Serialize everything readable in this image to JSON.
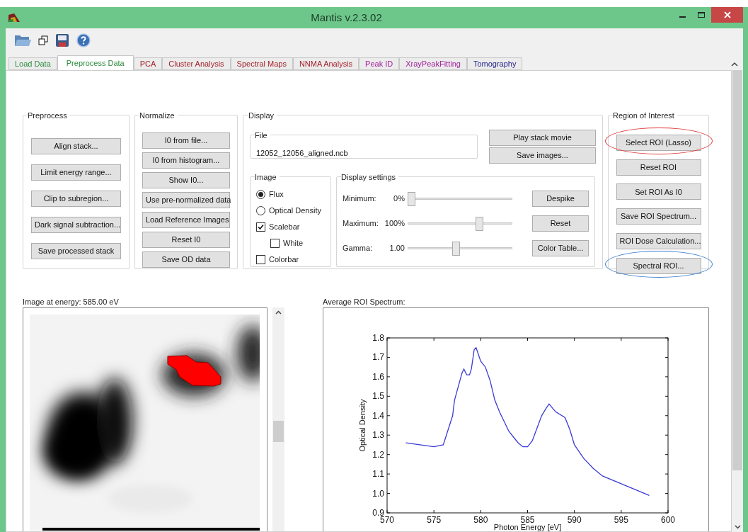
{
  "window": {
    "title": "Mantis v.2.3.02"
  },
  "tabs": [
    {
      "label": "Load Data",
      "selected": false,
      "color": "#2e8b3e"
    },
    {
      "label": "Preprocess Data",
      "selected": true,
      "color": "#2e8b3e"
    },
    {
      "label": "PCA",
      "selected": false,
      "color": "#a3212b"
    },
    {
      "label": "Cluster Analysis",
      "selected": false,
      "color": "#a3212b"
    },
    {
      "label": "Spectral Maps",
      "selected": false,
      "color": "#a3212b"
    },
    {
      "label": "NNMA Analysis",
      "selected": false,
      "color": "#a3212b"
    },
    {
      "label": "Peak ID",
      "selected": false,
      "color": "#a0209a"
    },
    {
      "label": "XrayPeakFitting",
      "selected": false,
      "color": "#a0209a"
    },
    {
      "label": "Tomography",
      "selected": false,
      "color": "#23238e"
    }
  ],
  "preprocess": {
    "title": "Preprocess",
    "buttons": [
      "Align stack...",
      "Limit energy range...",
      "Clip to subregion...",
      "Dark signal subtraction...",
      "Save processed stack"
    ]
  },
  "normalize": {
    "title": "Normalize",
    "buttons": [
      "I0 from file...",
      "I0 from histogram...",
      "Show I0...",
      "Use pre-normalized data",
      "Load Reference Images",
      "Reset I0",
      "Save OD data"
    ]
  },
  "display": {
    "title": "Display",
    "file": {
      "title": "File",
      "value": "12052_12056_aligned.ncb"
    },
    "buttons": [
      "Play stack movie",
      "Save images..."
    ],
    "image": {
      "title": "Image",
      "options": [
        {
          "kind": "radio",
          "label": "Flux",
          "selected": true
        },
        {
          "kind": "radio",
          "label": "Optical Density",
          "selected": false
        },
        {
          "kind": "checkbox",
          "label": "Scalebar",
          "checked": true,
          "children": [
            {
              "kind": "checkbox",
              "label": "White",
              "checked": false
            }
          ]
        },
        {
          "kind": "checkbox",
          "label": "Colorbar",
          "checked": false
        }
      ]
    },
    "settings": {
      "title": "Display settings",
      "rows": [
        {
          "label": "Minimum:",
          "reading": "0%",
          "level": 0,
          "button": "Despike"
        },
        {
          "label": "Maximum:",
          "reading": "100%",
          "level": 0.7,
          "button": "Reset"
        },
        {
          "label": "Gamma:",
          "reading": "1.00",
          "level": 0.46,
          "button": "Color Table..."
        }
      ]
    }
  },
  "roi": {
    "title": "Region of Interest",
    "buttons": [
      {
        "label": "Select ROI (Lasso)",
        "color": "#e03b3b"
      },
      {
        "label": "Reset ROI"
      },
      {
        "label": "Set ROI As I0"
      },
      {
        "label": "Save ROI Spectrum..."
      },
      {
        "label": "ROI Dose Calculation..."
      },
      {
        "label": "Spectral ROI...",
        "color": "#3b7fd0"
      }
    ]
  },
  "image_panel": {
    "title": "Image at energy: 585.00 eV",
    "kind": "picture"
  },
  "spectrum_panel": {
    "title": "Average ROI Spectrum:",
    "chart_data": {
      "type": "line",
      "xlabel": "Photon Energy [eV]",
      "ylabel": "Optical Density",
      "x": [
        572,
        575,
        576,
        577,
        577.2,
        578,
        578.2,
        578.5,
        578.8,
        579,
        579.3,
        579.5,
        580,
        580.5,
        581,
        581.5,
        582,
        583,
        583.5,
        584,
        584.5,
        585,
        585.5,
        586.5,
        587,
        587.3,
        588,
        589,
        589.5,
        590,
        591,
        592,
        593,
        595,
        598
      ],
      "series": [
        {
          "color": "#3a3ad6",
          "values": [
            1.26,
            1.24,
            1.25,
            1.4,
            1.48,
            1.62,
            1.64,
            1.61,
            1.61,
            1.64,
            1.74,
            1.75,
            1.68,
            1.65,
            1.58,
            1.48,
            1.42,
            1.32,
            1.29,
            1.26,
            1.24,
            1.24,
            1.27,
            1.4,
            1.44,
            1.46,
            1.42,
            1.39,
            1.33,
            1.25,
            1.18,
            1.13,
            1.09,
            1.05,
            0.99
          ]
        }
      ],
      "xlim": [
        570,
        600
      ],
      "ylim": [
        0.9,
        1.8
      ],
      "xticks": [
        570,
        575,
        580,
        585,
        590,
        595,
        600
      ],
      "yticks": [
        {
          "value": 0.9,
          "label": "0.9"
        },
        {
          "value": 1.0,
          "label": "1.0"
        },
        {
          "value": 1.1,
          "label": "1.1"
        },
        {
          "value": 1.2,
          "label": "1.2"
        },
        {
          "value": 1.3,
          "label": "1.3"
        },
        {
          "value": 1.4,
          "label": "1.4"
        },
        {
          "value": 1.5,
          "label": "1.5"
        },
        {
          "value": 1.6,
          "label": "1.6"
        },
        {
          "value": 1.7,
          "label": "1.7"
        },
        {
          "value": 1.8,
          "label": "1.8"
        }
      ]
    }
  }
}
